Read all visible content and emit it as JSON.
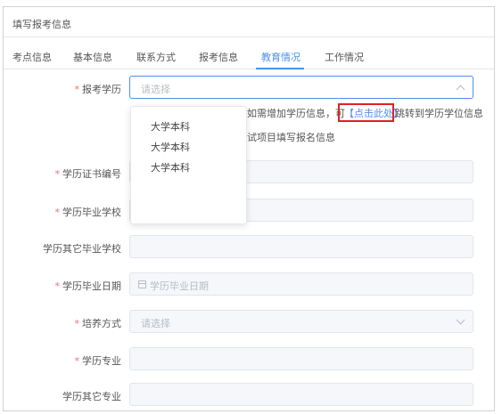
{
  "header": {
    "title": "填写报考信息"
  },
  "tabs": [
    "考点信息",
    "基本信息",
    "联系方式",
    "报考信息",
    "教育情况",
    "工作情况"
  ],
  "active_tab": "教育情况",
  "form": {
    "education_level": {
      "label": "报考学历",
      "required": true,
      "placeholder": "请选择"
    },
    "note_line1_before": "如需增加学历信息，可",
    "note_link": "【点击此处】",
    "note_line1_after": "跳转到学历学位信息",
    "note_line2": "试项目填写报名信息",
    "certificate_number": {
      "label": "学历证书编号",
      "required": true
    },
    "graduation_school": {
      "label": "学历毕业学校",
      "required": true
    },
    "other_graduation_school": {
      "label": "学历其它毕业学校",
      "required": false
    },
    "graduation_date": {
      "label": "学历毕业日期",
      "required": true,
      "placeholder": "学历毕业日期"
    },
    "training_mode": {
      "label": "培养方式",
      "required": true,
      "placeholder": "请选择"
    },
    "major": {
      "label": "学历专业",
      "required": true
    },
    "other_major": {
      "label": "学历其它专业",
      "required": false
    }
  },
  "dropdown": {
    "options": [
      "大学本科",
      "大学本科",
      "大学本科"
    ]
  },
  "colors": {
    "accent": "#4c8ff0",
    "required": "#f56c6c",
    "highlight_box": "#e02020"
  }
}
